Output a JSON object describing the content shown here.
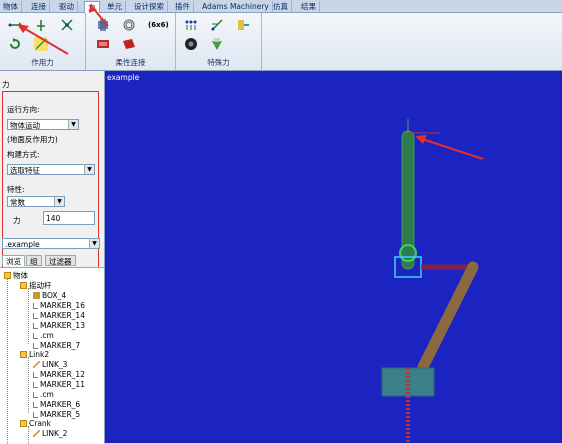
{
  "menu_tabs": [
    "物体",
    "连接",
    "驱动",
    "力",
    "单元",
    "设计探索",
    "插件",
    "Adams Machinery",
    "仿真",
    "结果"
  ],
  "ribbon": {
    "group_force": "作用力",
    "group_flexible": "柔性连接",
    "group_special": "特殊力",
    "flex_label_6x6": "(6x6)"
  },
  "left_panel": {
    "header": "力",
    "run_direction_label": "运行方向:",
    "run_direction_value": "物体运动",
    "ground_note": "(地面反作用力)",
    "construction_label": "构建方式:",
    "construction_value": "选取特征",
    "property_label": "特性:",
    "property_value": "常数",
    "force_label": "力",
    "force_value": "140",
    "model_select": ".example"
  },
  "browser_tabs": [
    "浏览",
    "组",
    "过滤器"
  ],
  "tree": {
    "root": "物体",
    "part1": "摇动杆",
    "part1_children": [
      "BOX_4",
      "MARKER_16",
      "MARKER_14",
      "MARKER_13",
      ".cm",
      "MARKER_7"
    ],
    "part2": "Link2",
    "part2_children": [
      "LINK_3",
      "MARKER_12",
      "MARKER_11",
      ".cm",
      "MARKER_6",
      "MARKER_5"
    ],
    "part3": "Crank",
    "part3_children": [
      "LINK_2"
    ]
  },
  "viewport": {
    "model_label": "example",
    "background_color": "#1b24c0"
  },
  "colors": {
    "annotation_red": "#e03030",
    "body_green": "#2e7d4a",
    "link_brown": "#8a6a3e"
  }
}
